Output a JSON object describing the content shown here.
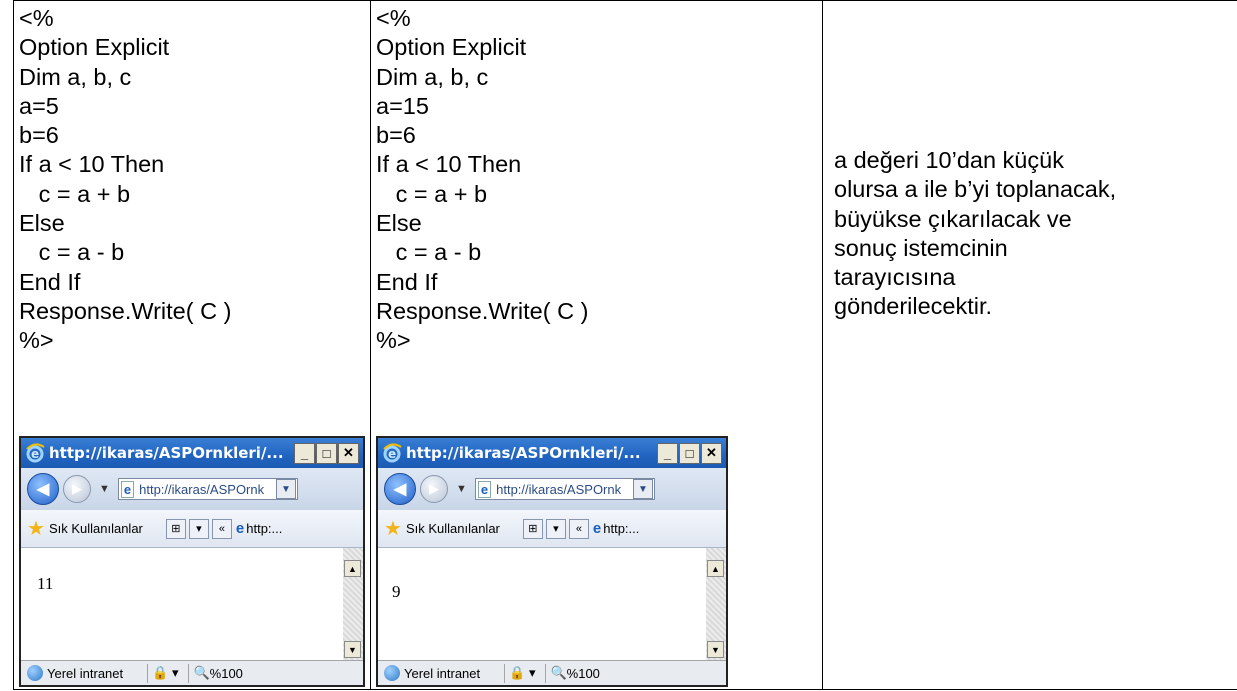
{
  "columns": [
    {
      "code": [
        "<%",
        "Option Explicit",
        "Dim a, b, c",
        "a=5",
        "b=6",
        "If a < 10 Then",
        "   c = a + b",
        "Else",
        "   c = a - b",
        "End If",
        "Response.Write( C )",
        "%>"
      ],
      "browser": {
        "title": "http://ikaras/ASPOrnkleri/...",
        "address": "http://ikaras/ASPOrnk",
        "favorites_label": "Sık Kullanılanlar",
        "tab_label": "http:...",
        "output": "11",
        "status_zone": "Yerel intranet",
        "zoom": "%100"
      }
    },
    {
      "code": [
        "<%",
        "Option Explicit",
        "Dim a, b, c",
        "a=15",
        "b=6",
        "If a < 10 Then",
        "   c = a + b",
        "Else",
        "   c = a - b",
        "End If",
        "Response.Write( C )",
        "%>"
      ],
      "browser": {
        "title": "http://ikaras/ASPOrnkleri/...",
        "address": "http://ikaras/ASPOrnk",
        "favorites_label": "Sık Kullanılanlar",
        "tab_label": "http:...",
        "output": "9",
        "status_zone": "Yerel intranet",
        "zoom": "%100"
      }
    }
  ],
  "description": [
    "a değeri 10’dan küçük",
    "olursa a ile b’yi toplanacak,",
    "büyükse çıkarılacak ve",
    "sonuç istemcinin",
    "tarayıcısına",
    "gönderilecektir."
  ],
  "icons": {
    "ie_logo": "ie-logo-icon",
    "back": "back-arrow-icon",
    "forward": "forward-arrow-icon",
    "favorites": "star-icon",
    "globe": "intranet-globe-icon",
    "zoom": "zoom-icon"
  }
}
